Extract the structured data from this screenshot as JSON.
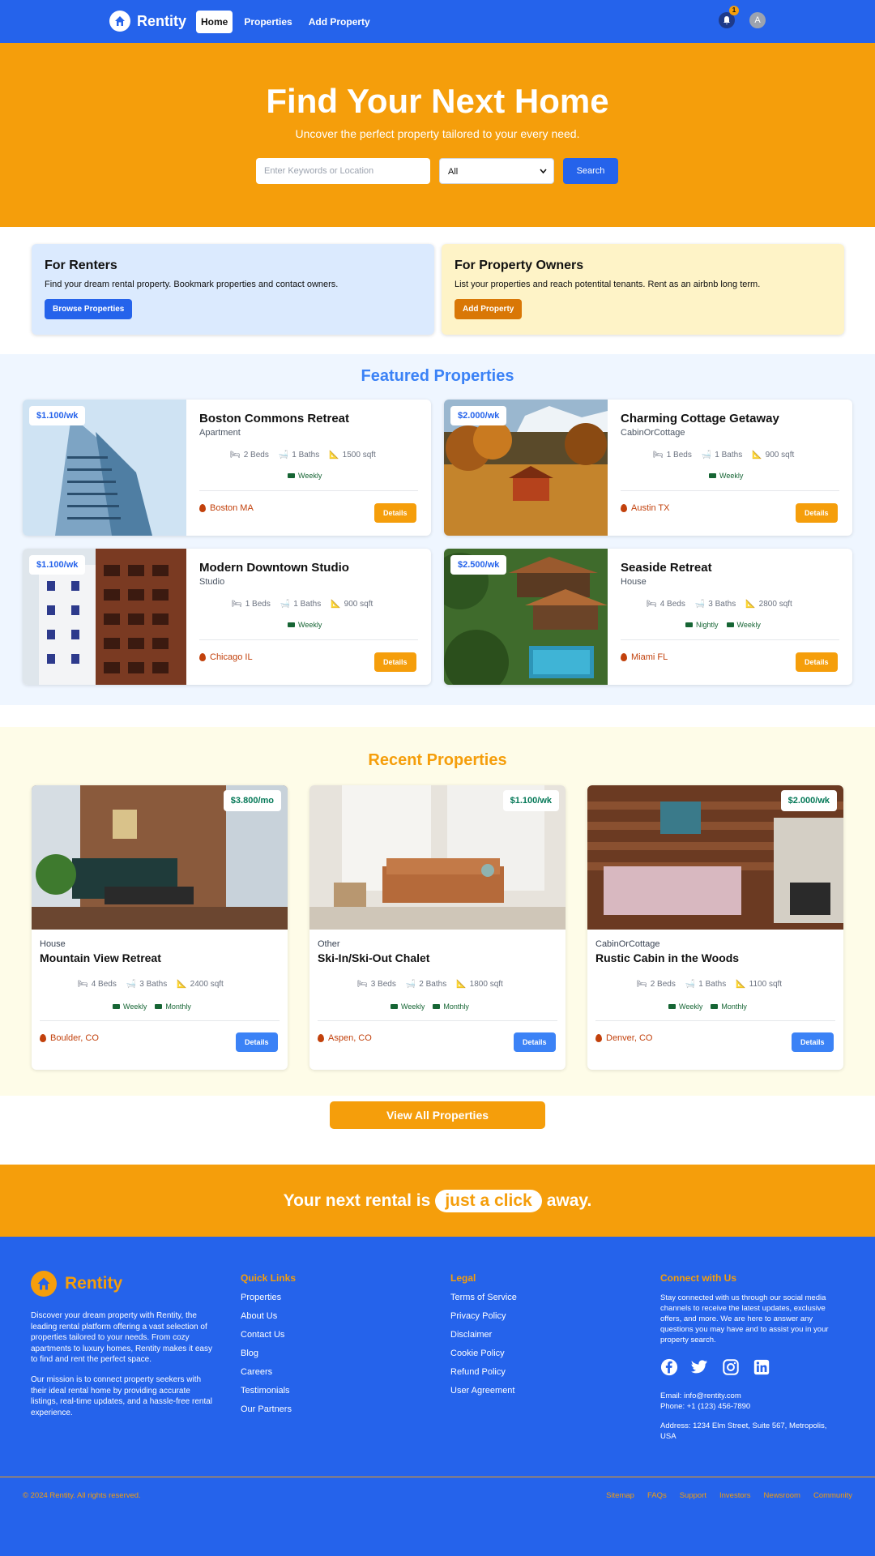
{
  "nav": {
    "brand": "Rentity",
    "links": [
      "Home",
      "Properties",
      "Add Property"
    ],
    "notification_count": "1",
    "avatar_initial": "A"
  },
  "hero": {
    "title": "Find Your Next Home",
    "subtitle": "Uncover the perfect property tailored to your every need.",
    "search_placeholder": "Enter Keywords or Location",
    "type_selected": "All",
    "search_button": "Search"
  },
  "roles": [
    {
      "title": "For Renters",
      "text": "Find your dream rental property. Bookmark properties and contact owners.",
      "button": "Browse Properties"
    },
    {
      "title": "For Property Owners",
      "text": "List your properties and reach potentital tenants. Rent as an airbnb long term.",
      "button": "Add Property"
    }
  ],
  "featured": {
    "title": "Featured Properties",
    "items": [
      {
        "price": "$1.100/wk",
        "name": "Boston Commons Retreat",
        "type": "Apartment",
        "beds": "2 Beds",
        "baths": "1 Baths",
        "sqft": "1500 sqft",
        "rates": [
          "Weekly"
        ],
        "location": "Boston MA",
        "button": "Details"
      },
      {
        "price": "$2.000/wk",
        "name": "Charming Cottage Getaway",
        "type": "CabinOrCottage",
        "beds": "1 Beds",
        "baths": "1 Baths",
        "sqft": "900 sqft",
        "rates": [
          "Weekly"
        ],
        "location": "Austin TX",
        "button": "Details"
      },
      {
        "price": "$1.100/wk",
        "name": "Modern Downtown Studio",
        "type": "Studio",
        "beds": "1 Beds",
        "baths": "1 Baths",
        "sqft": "900 sqft",
        "rates": [
          "Weekly"
        ],
        "location": "Chicago IL",
        "button": "Details"
      },
      {
        "price": "$2.500/wk",
        "name": "Seaside Retreat",
        "type": "House",
        "beds": "4 Beds",
        "baths": "3 Baths",
        "sqft": "2800 sqft",
        "rates": [
          "Nightly",
          "Weekly"
        ],
        "location": "Miami FL",
        "button": "Details"
      }
    ]
  },
  "recent": {
    "title": "Recent Properties",
    "items": [
      {
        "price": "$3.800/mo",
        "type": "House",
        "name": "Mountain View Retreat",
        "beds": "4 Beds",
        "baths": "3 Baths",
        "sqft": "2400 sqft",
        "rates": [
          "Weekly",
          "Monthly"
        ],
        "location": "Boulder, CO",
        "button": "Details"
      },
      {
        "price": "$1.100/wk",
        "type": "Other",
        "name": "Ski-In/Ski-Out Chalet",
        "beds": "3 Beds",
        "baths": "2 Baths",
        "sqft": "1800 sqft",
        "rates": [
          "Weekly",
          "Monthly"
        ],
        "location": "Aspen, CO",
        "button": "Details"
      },
      {
        "price": "$2.000/wk",
        "type": "CabinOrCottage",
        "name": "Rustic Cabin in the Woods",
        "beds": "2 Beds",
        "baths": "1 Baths",
        "sqft": "1100 sqft",
        "rates": [
          "Weekly",
          "Monthly"
        ],
        "location": "Denver, CO",
        "button": "Details"
      }
    ],
    "view_all": "View All Properties"
  },
  "cta": {
    "before": "Your next rental is",
    "highlight": "just a click",
    "after": "away."
  },
  "footer": {
    "brand": "Rentity",
    "desc1": "Discover your dream property with Rentity, the leading rental platform offering a vast selection of properties tailored to your needs. From cozy apartments to luxury homes, Rentity makes it easy to find and rent the perfect space.",
    "desc2": "Our mission is to connect property seekers with their ideal rental home by providing accurate listings, real-time updates, and a hassle-free rental experience.",
    "quick_title": "Quick Links",
    "quick_links": [
      "Properties",
      "About Us",
      "Contact Us",
      "Blog",
      "Careers",
      "Testimonials",
      "Our Partners"
    ],
    "legal_title": "Legal",
    "legal_links": [
      "Terms of Service",
      "Privacy Policy",
      "Disclaimer",
      "Cookie Policy",
      "Refund Policy",
      "User Agreement"
    ],
    "connect_title": "Connect with Us",
    "connect_text": "Stay connected with us through our social media channels to receive the latest updates, exclusive offers, and more. We are here to answer any questions you may have and to assist you in your property search.",
    "social_icons": [
      "facebook-icon",
      "twitter-icon",
      "instagram-icon",
      "linkedin-icon"
    ],
    "email": "Email: info@rentity.com",
    "phone": "Phone: +1 (123) 456-7890",
    "address": "Address: 1234 Elm Street, Suite 567, Metropolis, USA",
    "copyright": "© 2024 Rentity. All rights reserved.",
    "bottom_links": [
      "Sitemap",
      "FAQs",
      "Support",
      "Investors",
      "Newsroom",
      "Community"
    ]
  },
  "colors": {
    "primary": "#2563eb",
    "accent": "#f59e0b",
    "location": "#c2410c",
    "price_green": "#047857"
  }
}
